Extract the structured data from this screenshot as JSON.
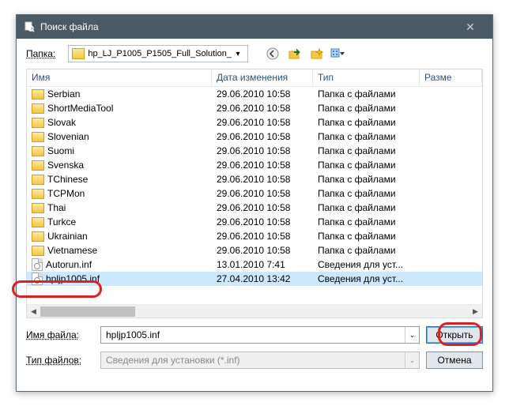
{
  "title": "Поиск файла",
  "toolbar": {
    "folder_label": "Папка:",
    "folder_value": "hp_LJ_P1005_P1505_Full_Solution_"
  },
  "columns": {
    "name": "Имя",
    "date": "Дата изменения",
    "type": "Тип",
    "size": "Разме"
  },
  "rows": [
    {
      "kind": "folder",
      "name": "Serbian",
      "date": "29.06.2010 10:58",
      "type": "Папка с файлами"
    },
    {
      "kind": "folder",
      "name": "ShortMediaTool",
      "date": "29.06.2010 10:58",
      "type": "Папка с файлами"
    },
    {
      "kind": "folder",
      "name": "Slovak",
      "date": "29.06.2010 10:58",
      "type": "Папка с файлами"
    },
    {
      "kind": "folder",
      "name": "Slovenian",
      "date": "29.06.2010 10:58",
      "type": "Папка с файлами"
    },
    {
      "kind": "folder",
      "name": "Suomi",
      "date": "29.06.2010 10:58",
      "type": "Папка с файлами"
    },
    {
      "kind": "folder",
      "name": "Svenska",
      "date": "29.06.2010 10:58",
      "type": "Папка с файлами"
    },
    {
      "kind": "folder",
      "name": "TChinese",
      "date": "29.06.2010 10:58",
      "type": "Папка с файлами"
    },
    {
      "kind": "folder",
      "name": "TCPMon",
      "date": "29.06.2010 10:58",
      "type": "Папка с файлами"
    },
    {
      "kind": "folder",
      "name": "Thai",
      "date": "29.06.2010 10:58",
      "type": "Папка с файлами"
    },
    {
      "kind": "folder",
      "name": "Turkce",
      "date": "29.06.2010 10:58",
      "type": "Папка с файлами"
    },
    {
      "kind": "folder",
      "name": "Ukrainian",
      "date": "29.06.2010 10:58",
      "type": "Папка с файлами"
    },
    {
      "kind": "folder",
      "name": "Vietnamese",
      "date": "29.06.2010 10:58",
      "type": "Папка с файлами"
    },
    {
      "kind": "inf",
      "name": "Autorun.inf",
      "date": "13.01.2010 7:41",
      "type": "Сведения для уст..."
    },
    {
      "kind": "inf",
      "name": "hpljp1005.inf",
      "date": "27.04.2010 13:42",
      "type": "Сведения для уст...",
      "selected": true
    }
  ],
  "bottom": {
    "filename_label": "Имя файла:",
    "filename_value": "hpljp1005.inf",
    "filetype_label": "Тип файлов:",
    "filetype_value": "Сведения для установки (*.inf)",
    "open_label": "Открыть",
    "cancel_label": "Отмена"
  }
}
